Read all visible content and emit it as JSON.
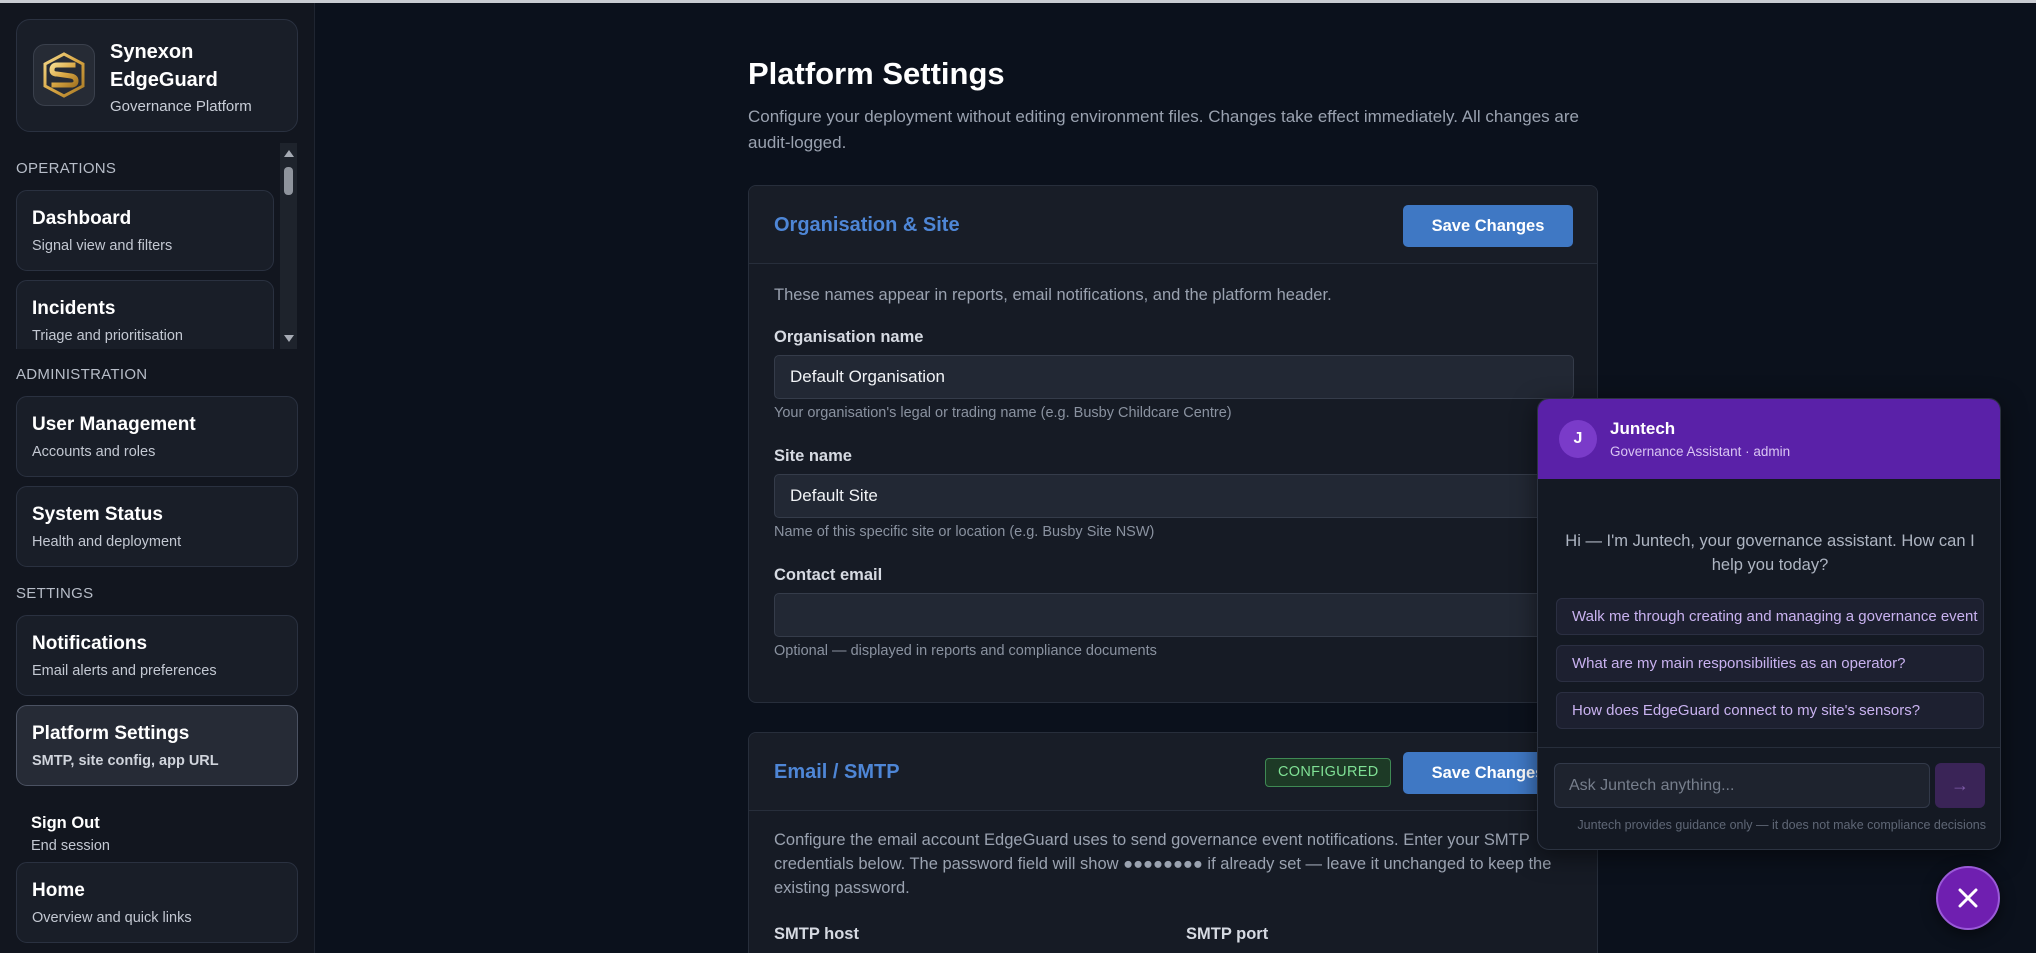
{
  "brand": {
    "name": "Synexon EdgeGuard",
    "subtitle": "Governance Platform"
  },
  "sidebar": {
    "sections": {
      "operations": "OPERATIONS",
      "administration": "ADMINISTRATION",
      "settings": "SETTINGS"
    },
    "items": [
      {
        "title": "Dashboard",
        "subtitle": "Signal view and filters"
      },
      {
        "title": "Incidents",
        "subtitle": "Triage and prioritisation"
      },
      {
        "title": "User Management",
        "subtitle": "Accounts and roles"
      },
      {
        "title": "System Status",
        "subtitle": "Health and deployment"
      },
      {
        "title": "Notifications",
        "subtitle": "Email alerts and preferences"
      },
      {
        "title": "Platform Settings",
        "subtitle": "SMTP, site config, app URL"
      },
      {
        "title": "Sign Out",
        "subtitle": "End session"
      },
      {
        "title": "Home",
        "subtitle": "Overview and quick links"
      }
    ]
  },
  "main": {
    "title": "Platform Settings",
    "description": "Configure your deployment without editing environment files. Changes take effect immediately. All changes are audit-logged.",
    "org_panel": {
      "title": "Organisation & Site",
      "save_label": "Save Changes",
      "intro": "These names appear in reports, email notifications, and the platform header.",
      "fields": [
        {
          "label": "Organisation name",
          "value": "Default Organisation",
          "hint": "Your organisation's legal or trading name (e.g. Busby Childcare Centre)"
        },
        {
          "label": "Site name",
          "value": "Default Site",
          "hint": "Name of this specific site or location (e.g. Busby Site NSW)"
        },
        {
          "label": "Contact email",
          "value": "",
          "hint": "Optional — displayed in reports and compliance documents"
        }
      ]
    },
    "smtp_panel": {
      "title": "Email / SMTP",
      "badge": "CONFIGURED",
      "save_label": "Save Changes",
      "intro": "Configure the email account EdgeGuard uses to send governance event notifications. Enter your SMTP credentials below. The password field will show ●●●●●●●● if already set — leave it unchanged to keep the existing password.",
      "host_label": "SMTP host",
      "port_label": "SMTP port"
    }
  },
  "chat": {
    "avatar_initial": "J",
    "name": "Juntech",
    "role": "Governance Assistant · admin",
    "greeting": "Hi — I'm Juntech, your governance assistant. How can I help you today?",
    "suggestions": [
      "Walk me through creating and managing a governance event",
      "What are my main responsibilities as an operator?",
      "How does EdgeGuard connect to my site's sensors?"
    ],
    "input_placeholder": "Ask Juntech anything...",
    "send_icon": "→",
    "footer": "Juntech provides guidance only — it does not make compliance decisions"
  },
  "colors": {
    "accent": "#3f78c4",
    "panel_title": "#4e86d6",
    "chat_header": "#5a21a8",
    "badge_text": "#7fe095",
    "fab": "#6f1fb0"
  },
  "icons": {
    "logo": "shield-s-logo-icon",
    "close": "close-icon",
    "send": "arrow-right-icon"
  }
}
